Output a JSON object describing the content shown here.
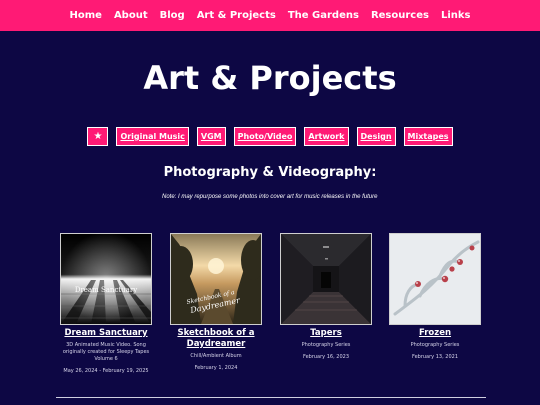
{
  "nav": {
    "items": [
      "Home",
      "About",
      "Blog",
      "Art & Projects",
      "The Gardens",
      "Resources",
      "Links"
    ]
  },
  "page": {
    "title": "Art & Projects"
  },
  "filters": {
    "star": "★",
    "items": [
      "Original Music",
      "VGM",
      "Photo/Video",
      "Artwork",
      "Design",
      "Mixtapes"
    ]
  },
  "section": {
    "heading": "Photography & Videography:",
    "note": "Note: I may repurpose some photos into cover art for music releases in the future"
  },
  "cards": [
    {
      "title": "Dream Sanctuary",
      "image_text": "Dream Sanctuary",
      "description": "3D Animated Music Video. Song originally created for Sleepy Tapes Volume 6",
      "date": "May 26, 2024 - February 19, 2025"
    },
    {
      "title": "Sketchbook of a Daydreamer",
      "description": "Chill/Ambient Album",
      "date": "February 1, 2024"
    },
    {
      "title": "Tapers",
      "description": "Photography Series",
      "date": "February 16, 2023"
    },
    {
      "title": "Frozen",
      "description": "Photography Series",
      "date": "February 13, 2021"
    }
  ],
  "colors": {
    "background": "#0d0744",
    "accent": "#ff1a75",
    "text": "#ffffff"
  }
}
